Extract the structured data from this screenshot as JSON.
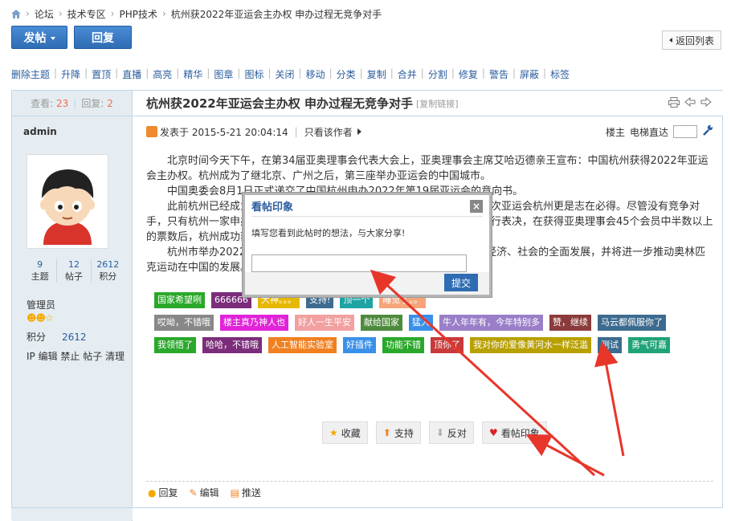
{
  "breadcrumb": {
    "items": [
      "论坛",
      "技术专区",
      "PHP技术",
      "杭州获2022年亚运会主办权 申办过程无竞争对手"
    ],
    "sep": "›"
  },
  "top_buttons": {
    "post": "发帖",
    "reply": "回复",
    "back": "返回列表"
  },
  "mod_actions": [
    "删除主题",
    "升降",
    "置顶",
    "直播",
    "高亮",
    "精华",
    "图章",
    "图标",
    "关闭",
    "移动",
    "分类",
    "复制",
    "合并",
    "分割",
    "修复",
    "警告",
    "屏蔽",
    "标签"
  ],
  "thread": {
    "views_label": "查看:",
    "views": "23",
    "replies_label": "回复:",
    "replies": "2",
    "title": "杭州获2022年亚运会主办权 申办过程无竞争对手",
    "copy_link": "[复制链接]"
  },
  "author": {
    "name": "admin",
    "topics": "9",
    "posts": "12",
    "credits": "2612",
    "topics_label": "主题",
    "posts_label": "帖子",
    "credits_label": "积分",
    "group": "管理员",
    "stars": "☻☻☆",
    "points_label": "积分",
    "points": "2612",
    "admin_links": "IP 编辑 禁止 帖子 清理"
  },
  "meta": {
    "posted": "发表于 2015-5-21 20:04:14",
    "only_author": "只看该作者",
    "floor": "楼主",
    "elevator": "电梯直达"
  },
  "content": [
    "北京时间今天下午，在第34届亚奥理事会代表大会上，亚奥理事会主席艾哈迈德亲王宣布：中国杭州获得2022年亚运会主办权。杭州成为了继北京、广州之后，第三座举办亚运会的中国城市。",
    "中国奥委会8月1日正式递交了中国杭州申办2022年第19届亚运会的意向书。",
    "此前杭州已经成为了亚运会候选城市，杭州申办亚运会的决心很大，本次亚运会杭州更是志在必得。尽管没有竞争对手，只有杭州一家申办，但亚奥理事会仍然坚持走流程，以差额选举方式进行表决，在获得亚奥理事会45个会员中半数以上的票数后，杭州成功获得亚运会举办权。",
    "杭州市举办2022年亚运会，对于推动杭州乃至浙江、中国东部地区的经济、社会的全面发展，并将进一步推动奥林匹克运动在中国的发展。"
  ],
  "tags": [
    [
      {
        "t": "国家希望咧",
        "c": "#2aa82a"
      },
      {
        "t": "666666",
        "c": "#7b2d7b"
      },
      {
        "t": "大神。。。",
        "c": "#e6b800"
      },
      {
        "t": "支持!",
        "c": "#3d6b8f"
      },
      {
        "t": "顶一个",
        "c": "#1fa3a3"
      },
      {
        "t": "睡觉了。。",
        "c": "#f6a57a"
      }
    ],
    [
      {
        "t": "哎呦，不错哦",
        "c": "#888"
      },
      {
        "t": "楼主真乃神人也",
        "c": "#e024d8"
      },
      {
        "t": "好人一生平安",
        "c": "#f2a0a0"
      },
      {
        "t": "献给国家",
        "c": "#4e8a3c"
      },
      {
        "t": "猛人",
        "c": "#3a90e8"
      },
      {
        "t": "牛人年年有，今年特别多",
        "c": "#9a7fc8"
      },
      {
        "t": "赞，继续",
        "c": "#8b3b3b"
      },
      {
        "t": "马云都佩服你了",
        "c": "#3d6b8f"
      }
    ],
    [
      {
        "t": "我领悟了",
        "c": "#2aa82a"
      },
      {
        "t": "哈哈，不错哦",
        "c": "#7b2d7b"
      },
      {
        "t": "人工智能实验室",
        "c": "#f08020"
      },
      {
        "t": "好插件",
        "c": "#3a90e8"
      },
      {
        "t": "功能不错",
        "c": "#2aa82a"
      },
      {
        "t": "顶你了",
        "c": "#c83a3a"
      },
      {
        "t": "我对你的爱像黄河水一样泛滥",
        "c": "#b8a000"
      },
      {
        "t": "测试",
        "c": "#3d6b8f"
      },
      {
        "t": "勇气可嘉",
        "c": "#1fa378"
      }
    ]
  ],
  "post_actions": {
    "fav": "收藏",
    "support": "支持",
    "oppose": "反对",
    "impress": "看帖印象"
  },
  "bottom_links": {
    "reply": "回复",
    "edit": "编辑",
    "push": "推送"
  },
  "modal": {
    "title": "看帖印象",
    "prompt": "填写您看到此帖时的想法，与大家分享!",
    "submit": "提交",
    "close": "×",
    "input_value": ""
  }
}
